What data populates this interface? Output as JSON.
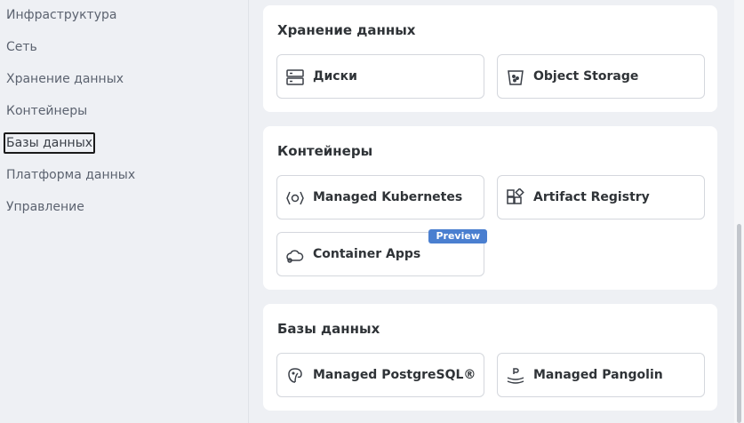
{
  "sidebar": {
    "items": [
      {
        "label": "Инфраструктура"
      },
      {
        "label": "Сеть"
      },
      {
        "label": "Хранение данных"
      },
      {
        "label": "Контейнеры"
      },
      {
        "label": "Базы данных"
      },
      {
        "label": "Платформа данных"
      },
      {
        "label": "Управление"
      }
    ],
    "active": "Базы данных"
  },
  "sections": [
    {
      "title": "Хранение данных",
      "tiles": [
        {
          "label": "Диски",
          "icon": "disks-icon"
        },
        {
          "label": "Object Storage",
          "icon": "bucket-icon"
        }
      ]
    },
    {
      "title": "Контейнеры",
      "tiles": [
        {
          "label": "Managed Kubernetes",
          "icon": "kubernetes-icon"
        },
        {
          "label": "Artifact Registry",
          "icon": "registry-icon"
        },
        {
          "label": "Container Apps",
          "icon": "cloud-apps-icon",
          "badge": "Preview"
        }
      ]
    },
    {
      "title": "Базы данных",
      "tiles": [
        {
          "label": "Managed PostgreSQL®",
          "icon": "postgresql-icon"
        },
        {
          "label": "Managed Pangolin",
          "icon": "pangolin-icon"
        }
      ]
    }
  ],
  "colors": {
    "background": "#eef0f4",
    "card": "#ffffff",
    "badge": "#4a7fd0",
    "text": "#2f3337"
  }
}
